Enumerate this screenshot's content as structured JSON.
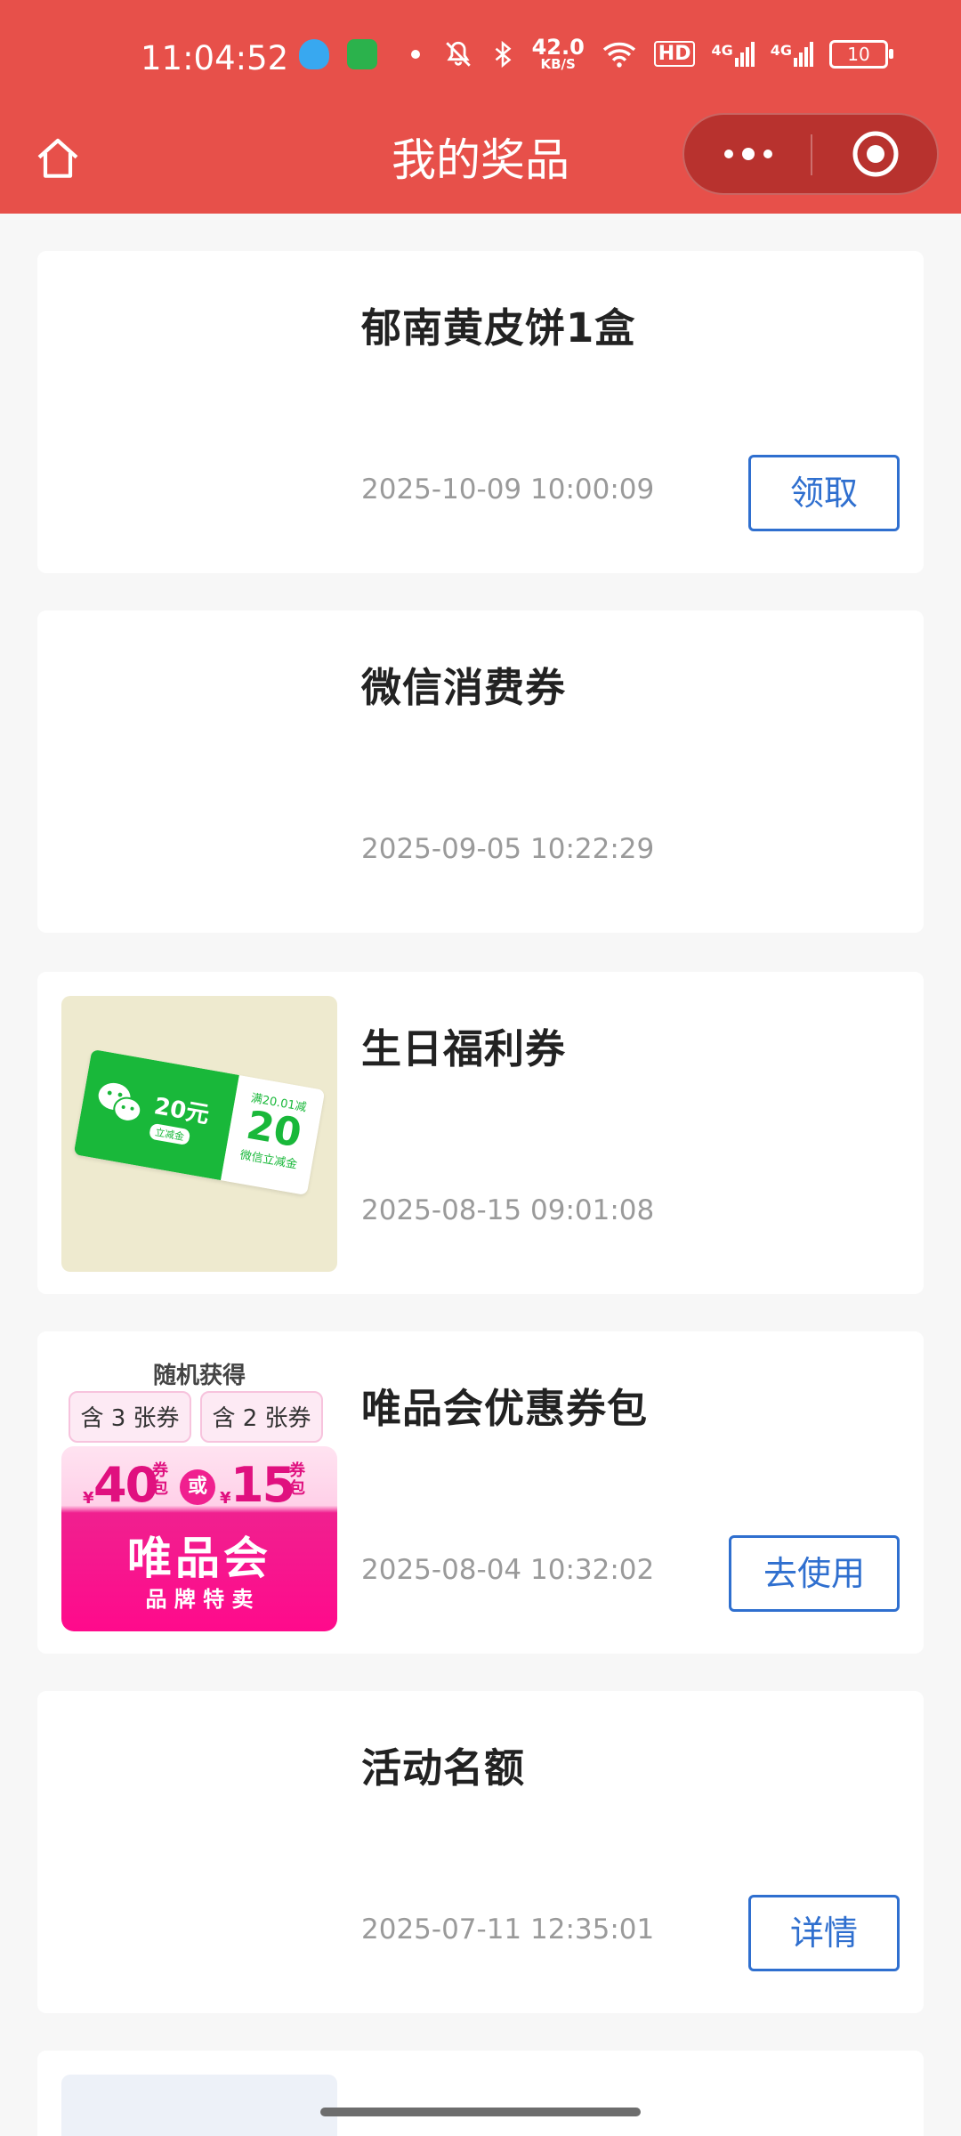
{
  "status_bar": {
    "time": "11:04:52",
    "net_speed_value": "42.0",
    "net_speed_unit": "KB/S",
    "hd_label": "HD",
    "signal1_label": "4G",
    "signal2_label": "4G",
    "battery_level": "10"
  },
  "nav": {
    "title": "我的奖品",
    "home_icon": "home-icon",
    "more_icon": "more-dots-icon",
    "close_icon": "miniprogram-close-icon"
  },
  "colors": {
    "header_bg": "#e7504a",
    "capsule_bg": "#b8322e",
    "button_blue": "#2f6fcf"
  },
  "prizes": [
    {
      "name": "郁南黄皮饼1盒",
      "date": "2025-10-09 10:00:09",
      "action": "领取",
      "thumb": "none"
    },
    {
      "name": "微信消费券",
      "date": "2025-09-05 10:22:29",
      "thumb": "none"
    },
    {
      "name": "生日福利券",
      "date": "2025-08-15 09:01:08",
      "thumb": "wechat-coupon",
      "thumb_text": {
        "amount": "20元",
        "tag": "立减金",
        "rule": "满20.01减",
        "big": "20",
        "sub": "微信立减金"
      }
    },
    {
      "name": "唯品会优惠券包",
      "date": "2025-08-04 10:32:02",
      "action": "去使用",
      "thumb": "vip-coupon",
      "thumb_text": {
        "top": "随机获得",
        "left_tag": "含 3 张券",
        "right_tag": "含 2 张券",
        "left_amount": "40",
        "right_amount": "15",
        "yen": "¥",
        "pack": "券包",
        "or": "或",
        "brand": "唯品会",
        "slogan": "品 牌 特 卖"
      }
    },
    {
      "name": "活动名额",
      "date": "2025-07-11 12:35:01",
      "action": "详情",
      "thumb": "none"
    }
  ]
}
